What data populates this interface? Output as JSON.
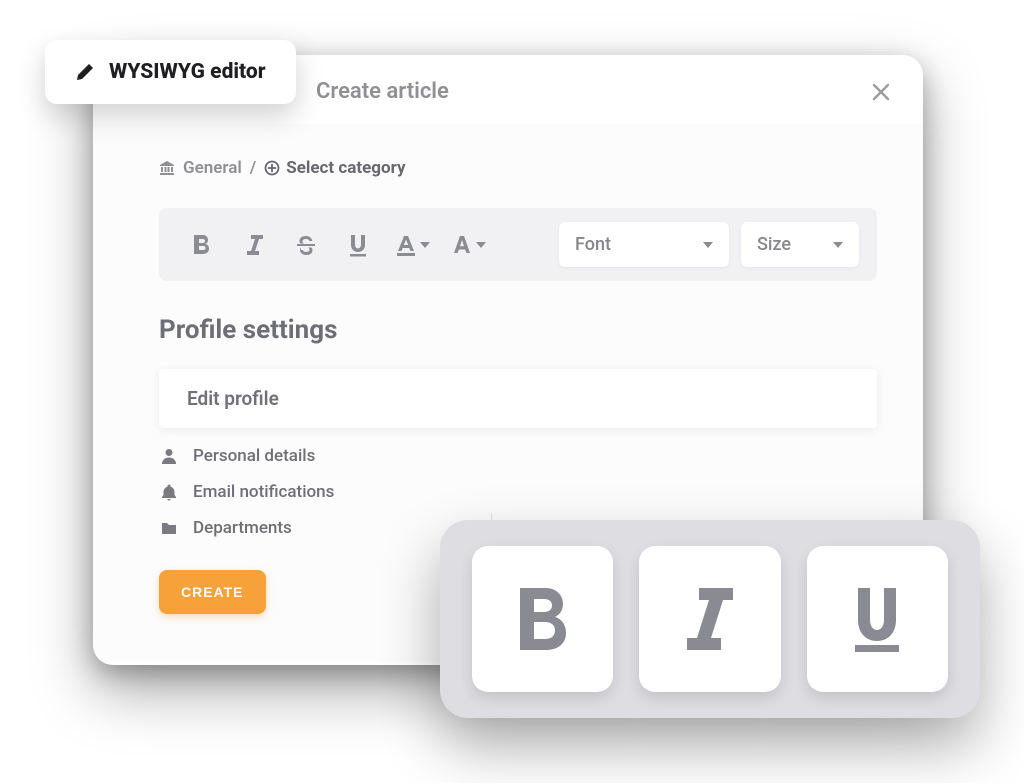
{
  "tag": {
    "label": "WYSIWYG editor"
  },
  "header": {
    "title": "Create article"
  },
  "breadcrumb": {
    "root": "General",
    "separator": "/",
    "select_label": "Select category"
  },
  "toolbar": {
    "font_label": "Font",
    "size_label": "Size"
  },
  "section_heading": "Profile settings",
  "content_row_label": "Edit profile",
  "sidebar_items": [
    {
      "label": "Personal details"
    },
    {
      "label": "Email notifications"
    },
    {
      "label": "Departments"
    }
  ],
  "create_button_label": "CREATE"
}
